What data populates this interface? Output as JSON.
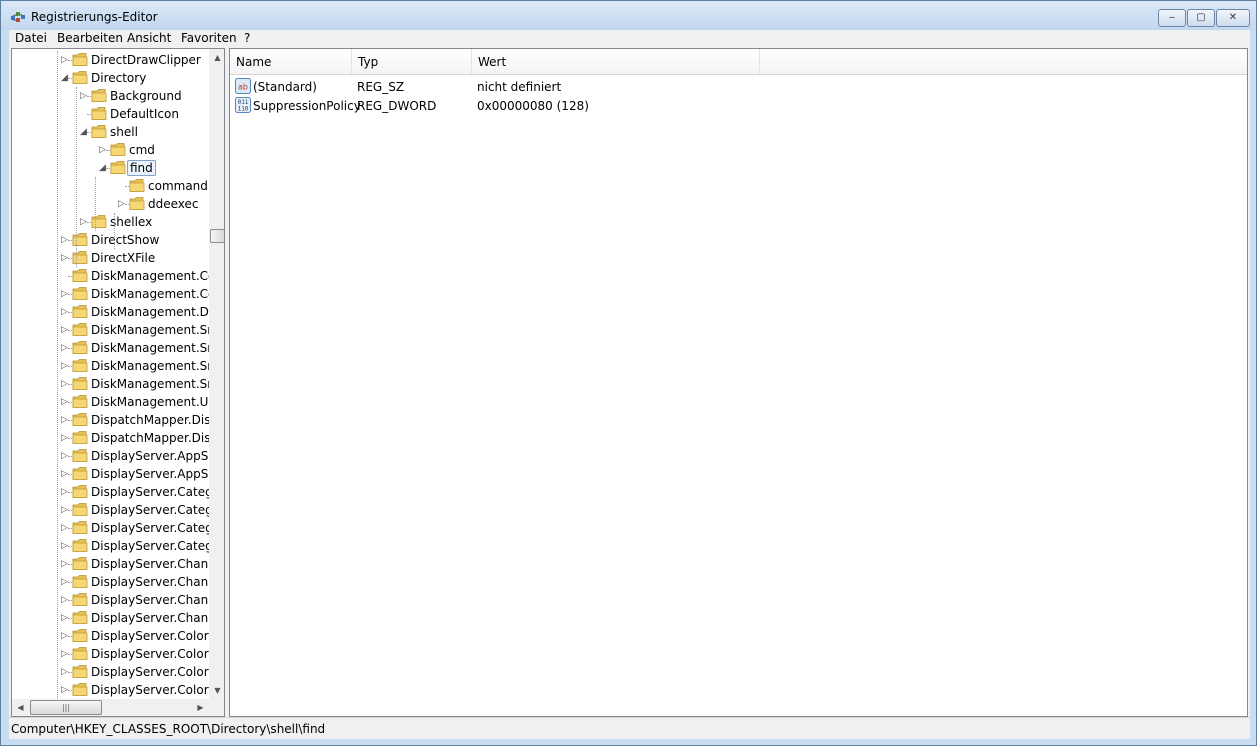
{
  "window": {
    "title": "Registrierungs-Editor",
    "caption_buttons": {
      "minimize": "‒",
      "maximize": "▢",
      "close": "✕"
    }
  },
  "menubar": {
    "items": [
      "Datei",
      "Bearbeiten",
      "Ansicht",
      "Favoriten",
      "?"
    ]
  },
  "tree": {
    "items": [
      {
        "label": "DirectDrawClipper",
        "level": 0,
        "expander": "▷"
      },
      {
        "label": "Directory",
        "level": 0,
        "expander": "◢"
      },
      {
        "label": "Background",
        "level": 1,
        "expander": "▷"
      },
      {
        "label": "DefaultIcon",
        "level": 1,
        "expander": ""
      },
      {
        "label": "shell",
        "level": 1,
        "expander": "◢"
      },
      {
        "label": "cmd",
        "level": 2,
        "expander": "▷"
      },
      {
        "label": "find",
        "level": 2,
        "expander": "◢",
        "selected": true
      },
      {
        "label": "command",
        "level": 3,
        "expander": ""
      },
      {
        "label": "ddeexec",
        "level": 3,
        "expander": "▷"
      },
      {
        "label": "shellex",
        "level": 1,
        "expander": "▷"
      },
      {
        "label": "DirectShow",
        "level": 0,
        "expander": "▷"
      },
      {
        "label": "DirectXFile",
        "level": 0,
        "expander": "▷"
      },
      {
        "label": "DiskManagement.Cor",
        "level": 0,
        "expander": ""
      },
      {
        "label": "DiskManagement.Cor",
        "level": 0,
        "expander": "▷"
      },
      {
        "label": "DiskManagement.Dat",
        "level": 0,
        "expander": "▷"
      },
      {
        "label": "DiskManagement.Sna",
        "level": 0,
        "expander": "▷"
      },
      {
        "label": "DiskManagement.Sna",
        "level": 0,
        "expander": "▷"
      },
      {
        "label": "DiskManagement.Sna",
        "level": 0,
        "expander": "▷"
      },
      {
        "label": "DiskManagement.Sna",
        "level": 0,
        "expander": "▷"
      },
      {
        "label": "DiskManagement.UIT",
        "level": 0,
        "expander": "▷"
      },
      {
        "label": "DispatchMapper.Disp",
        "level": 0,
        "expander": "▷"
      },
      {
        "label": "DispatchMapper.Disp",
        "level": 0,
        "expander": "▷"
      },
      {
        "label": "DisplayServer.AppSett",
        "level": 0,
        "expander": "▷"
      },
      {
        "label": "DisplayServer.AppSett",
        "level": 0,
        "expander": "▷"
      },
      {
        "label": "DisplayServer.Categor",
        "level": 0,
        "expander": "▷"
      },
      {
        "label": "DisplayServer.Categor",
        "level": 0,
        "expander": "▷"
      },
      {
        "label": "DisplayServer.Categor",
        "level": 0,
        "expander": "▷"
      },
      {
        "label": "DisplayServer.Categor",
        "level": 0,
        "expander": "▷"
      },
      {
        "label": "DisplayServer.Change",
        "level": 0,
        "expander": "▷"
      },
      {
        "label": "DisplayServer.Change",
        "level": 0,
        "expander": "▷"
      },
      {
        "label": "DisplayServer.Change",
        "level": 0,
        "expander": "▷"
      },
      {
        "label": "DisplayServer.Change",
        "level": 0,
        "expander": "▷"
      },
      {
        "label": "DisplayServer.ColorCo",
        "level": 0,
        "expander": "▷"
      },
      {
        "label": "DisplayServer.ColorCo",
        "level": 0,
        "expander": "▷"
      },
      {
        "label": "DisplayServer.ColorSe",
        "level": 0,
        "expander": "▷"
      },
      {
        "label": "DisplayServer.ColorSe",
        "level": 0,
        "expander": "▷"
      }
    ],
    "scroll_up": "▲",
    "scroll_down": "▼",
    "scroll_left": "◀",
    "scroll_right": "▶",
    "hthumb_grip": "|||"
  },
  "values": {
    "columns": [
      "Name",
      "Typ",
      "Wert"
    ],
    "rows": [
      {
        "icon": "string-value-icon",
        "icon_text": "ab",
        "name": "(Standard)",
        "type": "REG_SZ",
        "data": "nicht definiert"
      },
      {
        "icon": "binary-value-icon",
        "icon_text": "011\n110",
        "name": "SuppressionPolicy",
        "type": "REG_DWORD",
        "data": "0x00000080 (128)"
      }
    ]
  },
  "statusbar": {
    "path": "Computer\\HKEY_CLASSES_ROOT\\Directory\\shell\\find"
  }
}
